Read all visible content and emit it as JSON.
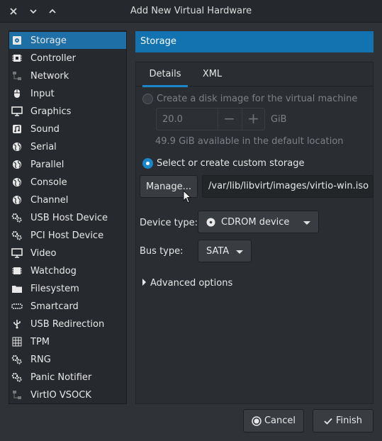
{
  "window": {
    "title": "Add New Virtual Hardware",
    "controls": [
      "close-icon",
      "minimize-icon",
      "maximize-icon"
    ]
  },
  "sidebar": {
    "items": [
      {
        "label": "Storage",
        "icon": "storage-icon",
        "selected": true
      },
      {
        "label": "Controller",
        "icon": "controller-icon"
      },
      {
        "label": "Network",
        "icon": "network-icon"
      },
      {
        "label": "Input",
        "icon": "mouse-icon"
      },
      {
        "label": "Graphics",
        "icon": "monitor-icon"
      },
      {
        "label": "Sound",
        "icon": "music-icon"
      },
      {
        "label": "Serial",
        "icon": "globe-icon"
      },
      {
        "label": "Parallel",
        "icon": "globe-icon"
      },
      {
        "label": "Console",
        "icon": "globe-icon"
      },
      {
        "label": "Channel",
        "icon": "globe-icon"
      },
      {
        "label": "USB Host Device",
        "icon": "gears-icon"
      },
      {
        "label": "PCI Host Device",
        "icon": "gears-icon"
      },
      {
        "label": "Video",
        "icon": "monitor-icon"
      },
      {
        "label": "Watchdog",
        "icon": "chip-icon"
      },
      {
        "label": "Filesystem",
        "icon": "folder-icon"
      },
      {
        "label": "Smartcard",
        "icon": "smartcard-icon"
      },
      {
        "label": "USB Redirection",
        "icon": "usb-icon"
      },
      {
        "label": "TPM",
        "icon": "tpm-icon"
      },
      {
        "label": "RNG",
        "icon": "gears-icon"
      },
      {
        "label": "Panic Notifier",
        "icon": "gears-icon"
      },
      {
        "label": "VirtIO VSOCK",
        "icon": "network-icon"
      }
    ]
  },
  "main": {
    "header": "Storage",
    "tabs": [
      {
        "label": "Details",
        "active": true
      },
      {
        "label": "XML",
        "active": false
      }
    ],
    "create_disk_label": "Create a disk image for the virtual machine",
    "create_disk_selected": false,
    "size_value": "20.0",
    "size_unit": "GiB",
    "available_text": "49.9 GiB available in the default location",
    "custom_storage_label": "Select or create custom storage",
    "custom_storage_selected": true,
    "manage_button": "Manage...",
    "storage_path": "/var/lib/libvirt/images/virtio-win.iso",
    "device_type_label": "Device type:",
    "device_type_value": "CDROM device",
    "bus_type_label": "Bus type:",
    "bus_type_value": "SATA",
    "advanced_options": "Advanced options"
  },
  "footer": {
    "cancel": "Cancel",
    "finish": "Finish"
  },
  "colors": {
    "accent": "#1273b0",
    "background": "#2f3237",
    "sidebar_selected": "#1e6fa6"
  }
}
